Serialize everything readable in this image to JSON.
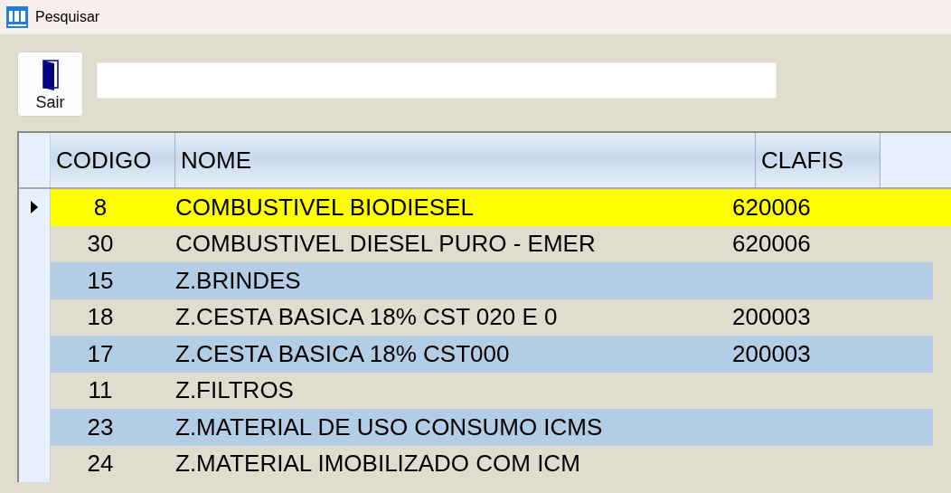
{
  "window": {
    "title": "Pesquisar"
  },
  "toolbar": {
    "exit_button": {
      "label": "Sair"
    }
  },
  "table": {
    "columns": [
      "CODIGO",
      "NOME",
      "CLAFIS"
    ],
    "rows": [
      {
        "codigo": "8",
        "nome": "COMBUSTIVEL BIODIESEL",
        "clafis": "620006",
        "selected": true
      },
      {
        "codigo": "30",
        "nome": "COMBUSTIVEL DIESEL PURO - EMER",
        "clafis": "620006",
        "selected": false
      },
      {
        "codigo": "15",
        "nome": "Z.BRINDES",
        "selected": false
      },
      {
        "codigo": "18",
        "nome": "Z.CESTA BASICA 18% CST 020 E 0",
        "clafis": "200003",
        "selected": false
      },
      {
        "codigo": "17",
        "nome": "Z.CESTA BASICA 18% CST000",
        "clafis": "200003",
        "selected": false
      },
      {
        "codigo": "11",
        "nome": "Z.FILTROS",
        "selected": false
      },
      {
        "codigo": "23",
        "nome": "Z.MATERIAL DE USO CONSUMO ICMS",
        "selected": false
      },
      {
        "codigo": "24",
        "nome": "Z.MATERIAL IMOBILIZADO COM ICM",
        "selected": false
      }
    ]
  }
}
